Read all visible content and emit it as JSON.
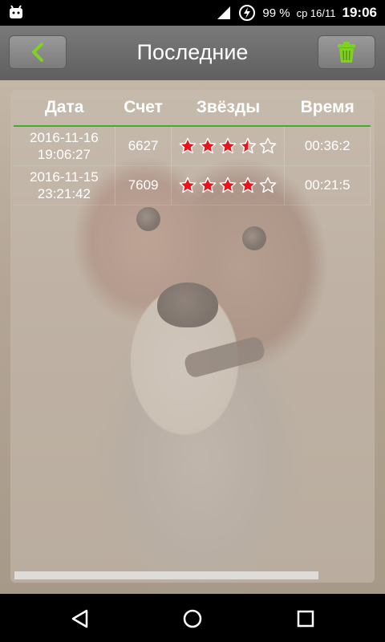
{
  "status_bar": {
    "battery": "99 %",
    "date": "ср 16/11",
    "time": "19:06"
  },
  "toolbar": {
    "title": "Последние"
  },
  "table": {
    "headers": [
      "Дата",
      "Счет",
      "Звёзды",
      "Время"
    ],
    "rows": [
      {
        "date": "2016-11-16",
        "time_of_day": "19:06:27",
        "score": "6627",
        "stars": 3.5,
        "duration": "00:36:2"
      },
      {
        "date": "2016-11-15",
        "time_of_day": "23:21:42",
        "score": "7609",
        "stars": 4,
        "duration": "00:21:5"
      }
    ],
    "max_stars": 5
  },
  "colors": {
    "accent_green": "#3fae2b",
    "star_red": "#e8141b",
    "star_outline": "#ffffff"
  },
  "icons": {
    "back": "chevron-left-icon",
    "delete": "trash-icon",
    "nav_back": "triangle-back-icon",
    "nav_home": "circle-home-icon",
    "nav_recents": "square-recents-icon"
  }
}
